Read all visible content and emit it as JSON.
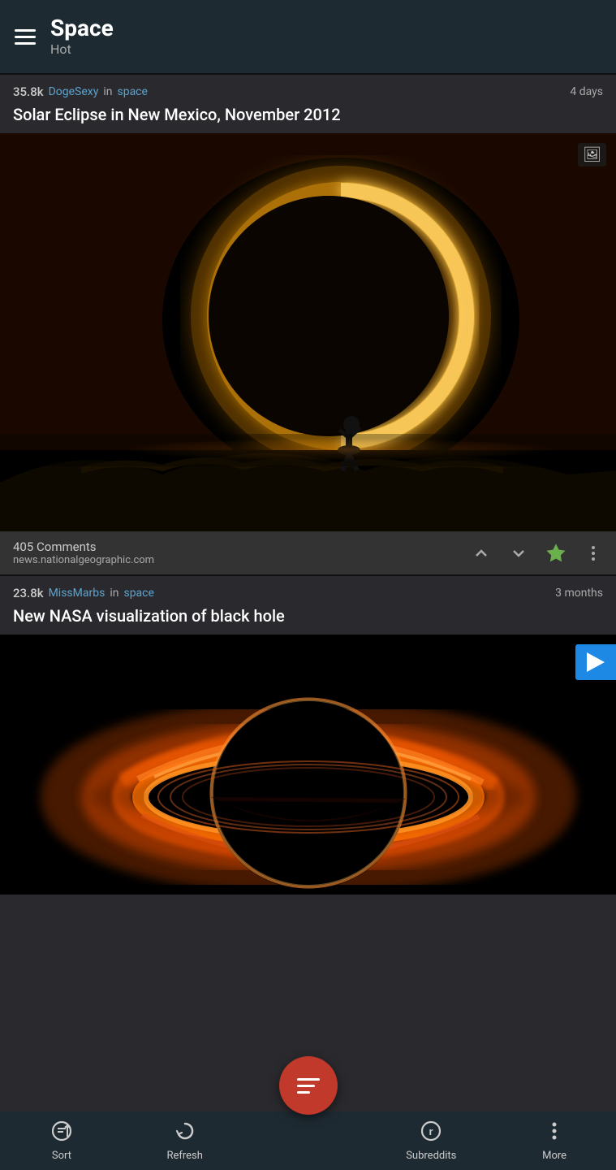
{
  "header": {
    "title": "Space",
    "subtitle": "Hot",
    "menu_icon": "menu-icon"
  },
  "posts": [
    {
      "id": "post1",
      "score": "35.8k",
      "author": "DogeSexy",
      "sub_label": "in",
      "subreddit": "space",
      "time": "4 days",
      "title": "Solar Eclipse in New Mexico, November 2012",
      "comments_count": "405 Comments",
      "domain": "news.nationalgeographic.com",
      "image_type": "eclipse",
      "has_image_icon": true
    },
    {
      "id": "post2",
      "score": "23.8k",
      "author": "MissMarbs",
      "sub_label": "in",
      "subreddit": "space",
      "time": "3 months",
      "title": "New NASA visualization of black hole",
      "comments_count": "",
      "domain": "",
      "image_type": "blackhole",
      "has_video": true
    }
  ],
  "bottomnav": {
    "sort_label": "Sort",
    "refresh_label": "Refresh",
    "subreddits_label": "Subreddits",
    "more_label": "More"
  },
  "actions": {
    "upvote_icon": "upvote-icon",
    "downvote_icon": "downvote-icon",
    "star_icon": "star-icon",
    "more_icon": "more-icon"
  }
}
